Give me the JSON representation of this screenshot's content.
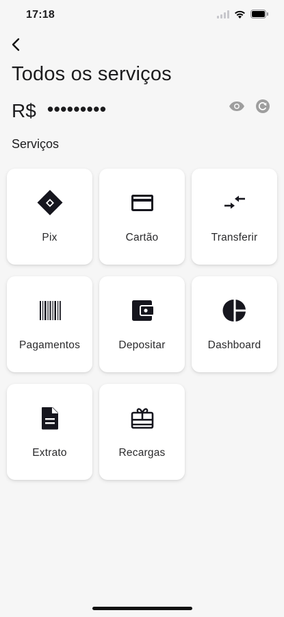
{
  "status": {
    "time": "17:18",
    "icons": [
      "signal-icon",
      "wifi-icon",
      "battery-icon"
    ]
  },
  "header": {
    "back_icon": "chevron-left-icon",
    "title": "Todos os serviços"
  },
  "balance": {
    "currency": "R$",
    "masked_value": "•••••••••",
    "toggle_icon": "eye-icon",
    "refresh_icon": "refresh-icon"
  },
  "section": {
    "title": "Serviços"
  },
  "services": [
    {
      "label": "Pix",
      "icon": "pix-icon"
    },
    {
      "label": "Cartão",
      "icon": "card-icon"
    },
    {
      "label": "Transferir",
      "icon": "transfer-icon"
    },
    {
      "label": "Pagamentos",
      "icon": "barcode-icon"
    },
    {
      "label": "Depositar",
      "icon": "wallet-icon"
    },
    {
      "label": "Dashboard",
      "icon": "pie-chart-icon"
    },
    {
      "label": "Extrato",
      "icon": "document-icon"
    },
    {
      "label": "Recargas",
      "icon": "gift-card-icon"
    }
  ],
  "colors": {
    "background": "#f6f6f6",
    "card": "#ffffff",
    "icon": "#16161e",
    "muted_icon": "#9e9e9e"
  }
}
